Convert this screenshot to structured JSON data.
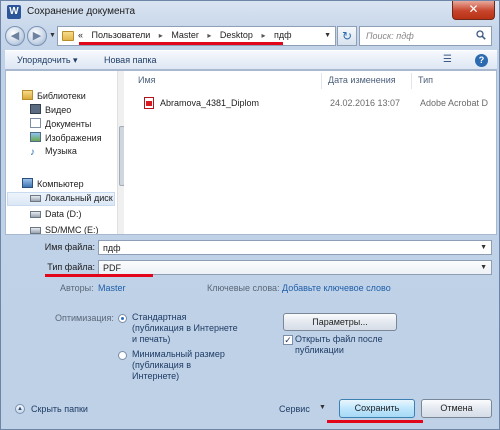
{
  "window": {
    "title": "Сохранение документа",
    "app_icon_letter": "W",
    "close_glyph": "✕"
  },
  "nav": {
    "back_glyph": "◀",
    "forward_glyph": "▶",
    "breadcrumb_prefix": "«",
    "breadcrumbs": [
      "Пользователи",
      "Master",
      "Desktop",
      "пдф"
    ],
    "search_placeholder": "Поиск: пдф",
    "refresh_glyph": "↻"
  },
  "toolbar": {
    "organize_label": "Упорядочить ▾",
    "new_folder_label": "Новая папка",
    "view_glyph": "☰",
    "help_glyph": "?"
  },
  "sidebar": {
    "items": [
      {
        "label": "Библиотеки",
        "icon": "library-icon"
      },
      {
        "label": "Видео",
        "icon": "video-icon"
      },
      {
        "label": "Документы",
        "icon": "documents-icon"
      },
      {
        "label": "Изображения",
        "icon": "pictures-icon"
      },
      {
        "label": "Музыка",
        "icon": "music-icon"
      },
      {
        "label": "Компьютер",
        "icon": "computer-icon"
      },
      {
        "label": "Локальный диск",
        "icon": "drive-icon"
      },
      {
        "label": "Data (D:)",
        "icon": "drive-icon"
      },
      {
        "label": "SD/MMC (E:)",
        "icon": "drive-icon"
      }
    ]
  },
  "files": {
    "columns": [
      "Имя",
      "Дата изменения",
      "Тип"
    ],
    "rows": [
      {
        "name": "Abramova_4381_Diplom",
        "date": "24.02.2016 13:07",
        "type": "Adobe Acrobat D"
      }
    ]
  },
  "form": {
    "filename_label": "Имя файла:",
    "filename_value": "пдф",
    "filetype_label": "Тип файла:",
    "filetype_value": "PDF",
    "authors_label": "Авторы:",
    "authors_value": "Master",
    "keywords_label": "Ключевые слова:",
    "keywords_value": "Добавьте ключевое слово",
    "optimize_label": "Оптимизация:",
    "opt_standard": "Стандартная (публикация в Интернете и печать)",
    "opt_minimal": "Минимальный размер (публикация в Интернете)",
    "params_button": "Параметры...",
    "open_after_label": "Открыть файл после публикации"
  },
  "footer": {
    "hide_folders_label": "Скрыть папки",
    "tools_label": "Сервис",
    "save_label": "Сохранить",
    "cancel_label": "Отмена"
  },
  "colors": {
    "highlight_red": "#e2061a",
    "link_blue": "#1f5ea8"
  }
}
